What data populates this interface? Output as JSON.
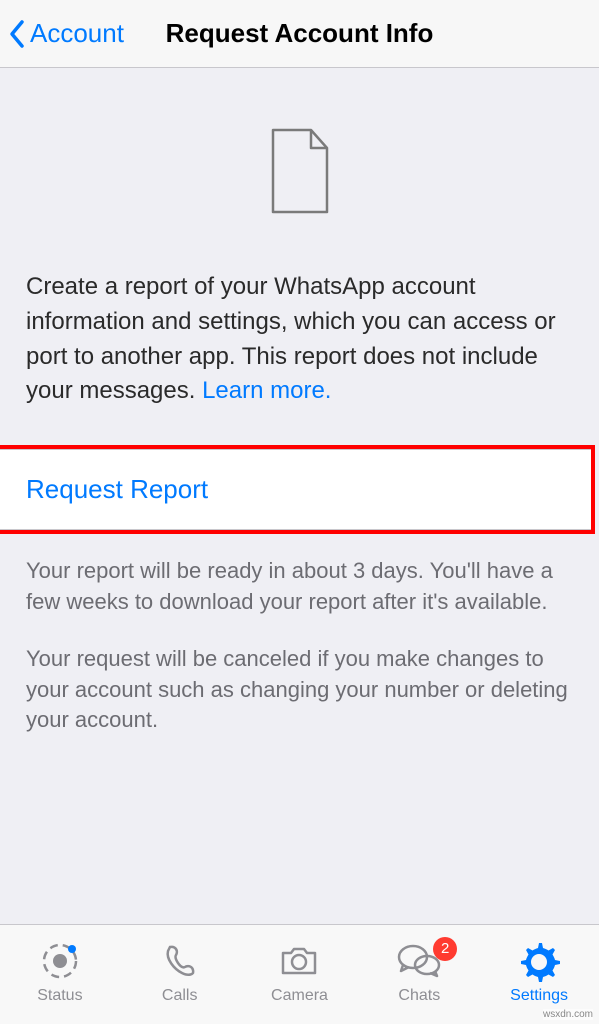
{
  "nav": {
    "back_label": "Account",
    "title": "Request Account Info"
  },
  "main": {
    "description": "Create a report of your WhatsApp account information and settings, which you can access or port to another app. This report does not include your messages. ",
    "learn_more": "Learn more.",
    "request_button": "Request Report",
    "footer1": "Your report will be ready in about 3 days. You'll have a few weeks to download your report after it's available.",
    "footer2": "Your request will be canceled if you make changes to your account such as changing your number or deleting your account."
  },
  "tabs": {
    "status": "Status",
    "calls": "Calls",
    "camera": "Camera",
    "chats": "Chats",
    "chats_badge": "2",
    "settings": "Settings"
  },
  "watermark": "wsxdn.com"
}
